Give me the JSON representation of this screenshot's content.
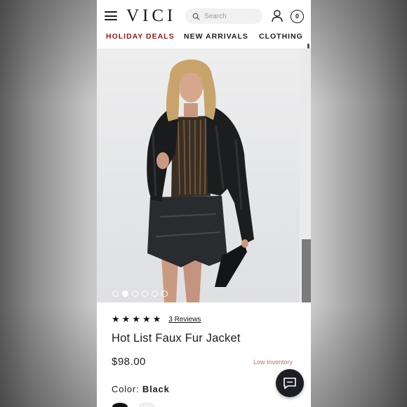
{
  "header": {
    "logo": "VICI",
    "search_placeholder": "Search",
    "cart_count": "0"
  },
  "nav": {
    "items": [
      "HOLIDAY DEALS",
      "NEW ARRIVALS",
      "CLOTHING"
    ]
  },
  "carousel": {
    "total_slides": 6,
    "active_slide": 2
  },
  "product": {
    "rating_stars": 5,
    "stars_text": "★★★★★",
    "reviews_label": "3 Reviews",
    "name": "Hot List Faux Fur Jacket",
    "price": "$98.00",
    "inventory_status": "Low Inventory",
    "color_label": "Color:",
    "color_value": "Black"
  },
  "colors": {
    "accent_deal": "#8b1a1a",
    "inventory": "#b07a6a",
    "chat_button": "#1d1d24"
  },
  "icons": [
    "hamburger-icon",
    "search-icon",
    "user-icon",
    "cart-icon",
    "chat-icon",
    "star-icon"
  ]
}
